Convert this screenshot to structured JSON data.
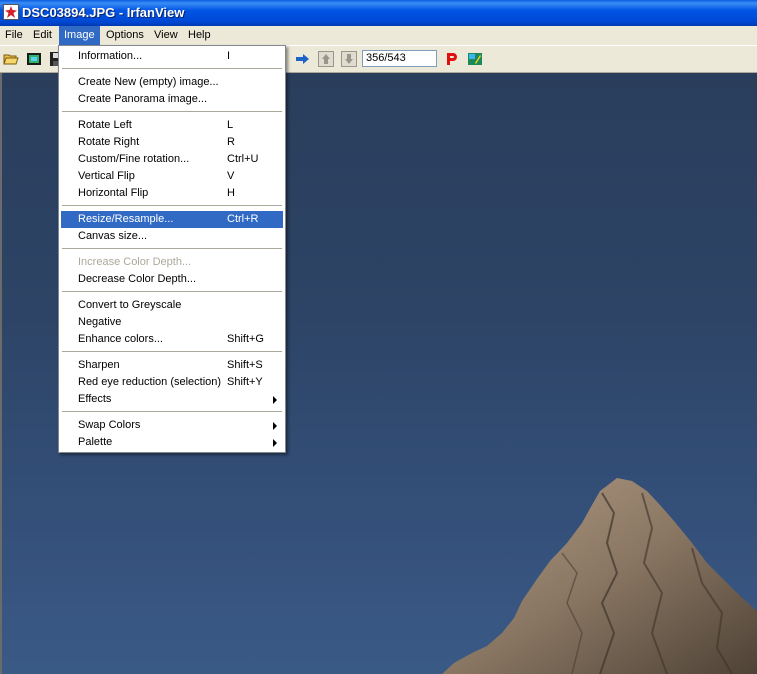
{
  "window": {
    "title": "DSC03894.JPG - IrfanView",
    "icon": "irfanview-app-icon"
  },
  "menubar": {
    "items": [
      "File",
      "Edit",
      "Image",
      "Options",
      "View",
      "Help"
    ],
    "active": "Image"
  },
  "toolbar": {
    "counter": "356/543",
    "buttons": [
      "open-folder",
      "thumbnails",
      "save",
      "next",
      "move-up",
      "move-down",
      "properties",
      "paint"
    ]
  },
  "image_menu": {
    "items": [
      {
        "label": "Information...",
        "shortcut": "I"
      },
      {
        "label": "Create New (empty) image...",
        "shortcut": ""
      },
      {
        "label": "Create Panorama image...",
        "shortcut": ""
      },
      {
        "label": "Rotate Left",
        "shortcut": "L"
      },
      {
        "label": "Rotate Right",
        "shortcut": "R"
      },
      {
        "label": "Custom/Fine rotation...",
        "shortcut": "Ctrl+U"
      },
      {
        "label": "Vertical Flip",
        "shortcut": "V"
      },
      {
        "label": "Horizontal Flip",
        "shortcut": "H"
      },
      {
        "label": "Resize/Resample...",
        "shortcut": "Ctrl+R",
        "highlighted": true
      },
      {
        "label": "Canvas size...",
        "shortcut": ""
      },
      {
        "label": "Increase Color Depth...",
        "shortcut": "",
        "disabled": true
      },
      {
        "label": "Decrease Color Depth...",
        "shortcut": ""
      },
      {
        "label": "Convert to Greyscale",
        "shortcut": ""
      },
      {
        "label": "Negative",
        "shortcut": ""
      },
      {
        "label": "Enhance colors...",
        "shortcut": "Shift+G"
      },
      {
        "label": "Sharpen",
        "shortcut": "Shift+S"
      },
      {
        "label": "Red eye reduction (selection)",
        "shortcut": "Shift+Y"
      },
      {
        "label": "Effects",
        "shortcut": "",
        "submenu": true
      },
      {
        "label": "Swap Colors",
        "shortcut": "",
        "submenu": true
      },
      {
        "label": "Palette",
        "shortcut": "",
        "submenu": true
      }
    ]
  },
  "colors": {
    "title_bar": "#0055e5",
    "menu_highlight": "#316ac5",
    "sky": "#2d4466",
    "rock": "#8a7763"
  }
}
